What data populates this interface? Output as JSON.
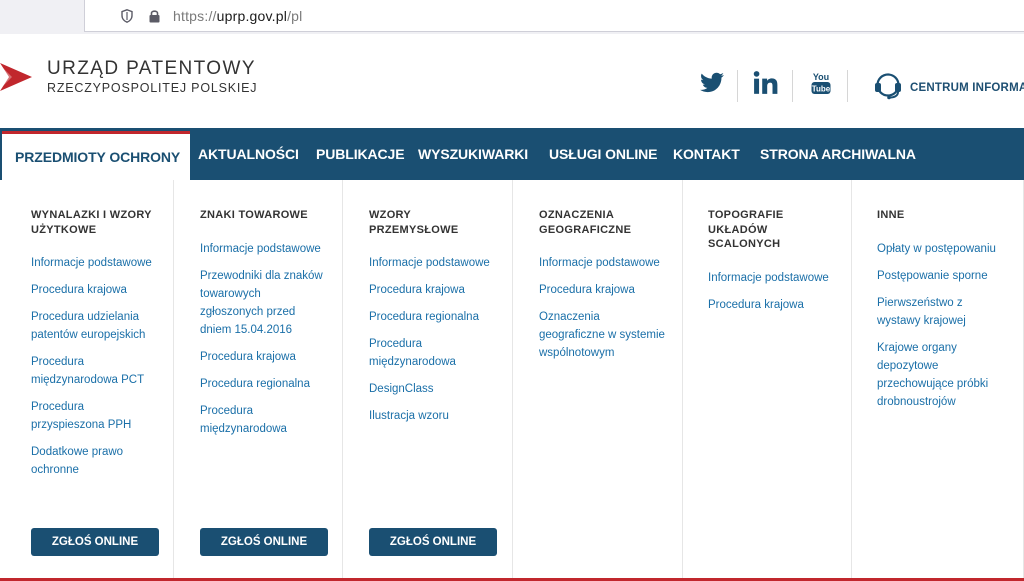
{
  "browser": {
    "url_prefix": "https://",
    "url_domain": "uprp.gov.pl",
    "url_path": "/pl"
  },
  "header": {
    "logo_line1": "URZĄD PATENTOWY",
    "logo_line2": "RZECZYPOSPOLITEJ POLSKIEJ",
    "social": [
      "twitter-icon",
      "linkedin-icon",
      "youtube-icon"
    ],
    "youtube_text": "You Tube",
    "contact_label": "CENTRUM INFORMA"
  },
  "colors": {
    "brand_blue": "#1a4f72",
    "link_blue": "#1a6fa8",
    "accent_red": "#c1272d"
  },
  "nav": {
    "items": [
      {
        "label": "PRZEDMIOTY OCHRONY"
      },
      {
        "label": "AKTUALNOŚCI"
      },
      {
        "label": "PUBLIKACJE"
      },
      {
        "label": "WYSZUKIWARKI"
      },
      {
        "label": "USŁUGI ONLINE"
      },
      {
        "label": "KONTAKT"
      },
      {
        "label": "STRONA ARCHIWALNA"
      }
    ]
  },
  "menu": {
    "columns": [
      {
        "title_lines": [
          "WYNALAZKI I WZORY",
          "UŻYTKOWE"
        ],
        "links": [
          [
            "Informacje podstawowe"
          ],
          [
            "Procedura krajowa"
          ],
          [
            "Procedura udzielania",
            "patentów europejskich"
          ],
          [
            "Procedura",
            "międzynarodowa PCT"
          ],
          [
            "Procedura",
            "przyspieszona PPH"
          ],
          [
            "Dodatkowe prawo",
            "ochronne"
          ]
        ],
        "button": "ZGŁOŚ ONLINE"
      },
      {
        "title_lines": [
          "ZNAKI TOWAROWE"
        ],
        "links": [
          [
            "Informacje podstawowe"
          ],
          [
            "Przewodniki dla znaków",
            "towarowych",
            "zgłoszonych przed",
            "dniem 15.04.2016"
          ],
          [
            "Procedura krajowa"
          ],
          [
            "Procedura regionalna"
          ],
          [
            "Procedura",
            "międzynarodowa"
          ]
        ],
        "button": "ZGŁOŚ ONLINE"
      },
      {
        "title_lines": [
          "WZORY",
          "PRZEMYSŁOWE"
        ],
        "links": [
          [
            "Informacje podstawowe"
          ],
          [
            "Procedura krajowa"
          ],
          [
            "Procedura regionalna"
          ],
          [
            "Procedura",
            "międzynarodowa"
          ],
          [
            "DesignClass"
          ],
          [
            "Ilustracja wzoru"
          ]
        ],
        "button": "ZGŁOŚ ONLINE"
      },
      {
        "title_lines": [
          "OZNACZENIA",
          "GEOGRAFICZNE"
        ],
        "links": [
          [
            "Informacje podstawowe"
          ],
          [
            "Procedura krajowa"
          ],
          [
            "Oznaczenia",
            "geograficzne w systemie",
            "wspólnotowym"
          ]
        ],
        "button": ""
      },
      {
        "title_lines": [
          "TOPOGRAFIE",
          "UKŁADÓW",
          "SCALONYCH"
        ],
        "links": [
          [
            "Informacje podstawowe"
          ],
          [
            "Procedura krajowa"
          ]
        ],
        "button": ""
      },
      {
        "title_lines": [
          "INNE"
        ],
        "links": [
          [
            "Opłaty w postępowaniu"
          ],
          [
            "Postępowanie sporne"
          ],
          [
            "Pierwszeństwo z",
            "wystawy krajowej"
          ],
          [
            "Krajowe organy",
            "depozytowe",
            "przechowujące próbki",
            "drobnoustrojów"
          ]
        ],
        "button": ""
      }
    ]
  }
}
